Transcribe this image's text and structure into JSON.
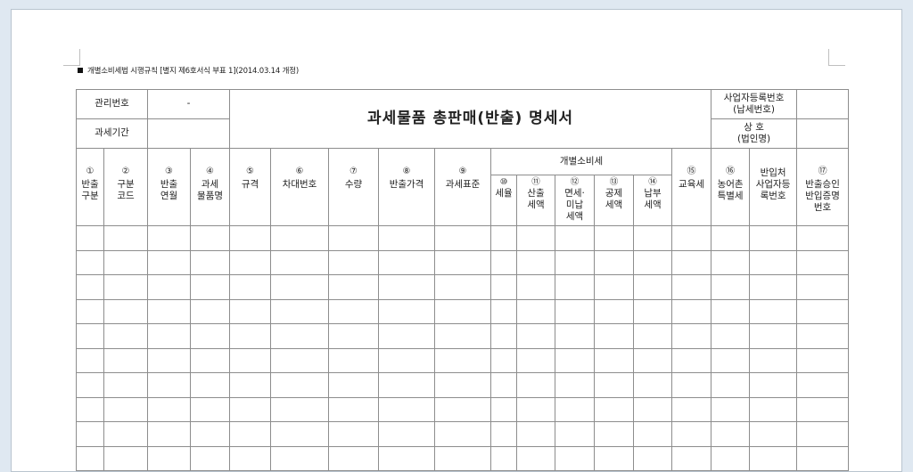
{
  "header_line": "개별소비세법 시행규칙 [별지 제6호서식 부표 1](2014.03.14 개정)",
  "title": "과세물품 총판매(반출) 명세서",
  "top_left": {
    "mgmt_no_label": "관리번호",
    "mgmt_no_value": "-",
    "period_label": "과세기간",
    "period_value": ""
  },
  "top_right": {
    "biz_reg_label": "사업자등록번호\n(납세번호)",
    "biz_reg_value": "",
    "company_label": "상    호\n(법인명)",
    "company_value": ""
  },
  "columns": [
    {
      "num": "①",
      "label": "반출\n구분"
    },
    {
      "num": "②",
      "label": "구분\n코드"
    },
    {
      "num": "③",
      "label": "반출\n연월"
    },
    {
      "num": "④",
      "label": "과세\n물품명"
    },
    {
      "num": "⑤",
      "label": "규격"
    },
    {
      "num": "⑥",
      "label": "차대번호"
    },
    {
      "num": "⑦",
      "label": "수량"
    },
    {
      "num": "⑧",
      "label": "반출가격"
    },
    {
      "num": "⑨",
      "label": "과세표준"
    },
    {
      "num": "⑮",
      "label": "교육세"
    },
    {
      "num": "⑯",
      "label": "농어촌\n특별세"
    },
    {
      "num": "",
      "label": "반입처\n사업자등\n록번호"
    },
    {
      "num": "⑰",
      "label": "반출승인\n반입증명\n번호"
    }
  ],
  "group": {
    "label": "개별소비세",
    "sub": [
      {
        "num": "⑩",
        "label": "세율"
      },
      {
        "num": "⑪",
        "label": "산출\n세액"
      },
      {
        "num": "⑫",
        "label": "면세·\n미납\n세액"
      },
      {
        "num": "⑬",
        "label": "공제\n세액"
      },
      {
        "num": "⑭",
        "label": "납부\n세액"
      }
    ]
  }
}
